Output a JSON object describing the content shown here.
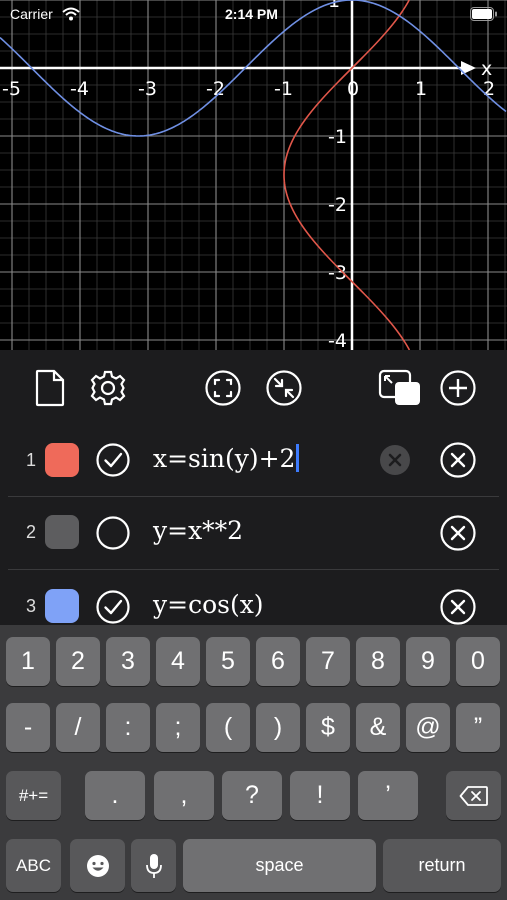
{
  "status_bar": {
    "carrier": "Carrier",
    "time": "2:14 PM"
  },
  "graph": {
    "axis_label_x": "x",
    "x_ticks": [
      "-5",
      "-4",
      "-3",
      "-2",
      "-1",
      "0",
      "1",
      "2"
    ],
    "y_ticks": [
      "1",
      "-1",
      "-2",
      "-3",
      "-4"
    ],
    "curve_colors": {
      "eq1": "#e0574a",
      "eq3": "#6f8fe3"
    }
  },
  "toolbar": {
    "new_doc": "doc-icon",
    "settings": "gear-icon",
    "fit_view": "fit-view-icon",
    "zoom_in": "compress-icon",
    "switch_view": "window-switch-icon",
    "add": "plus-circle-icon"
  },
  "equations": [
    {
      "index": "1",
      "color": "#ef6a5a",
      "checked": true,
      "text": "x=sin(y)+2",
      "editing": true
    },
    {
      "index": "2",
      "color": "#5d5d5f",
      "checked": false,
      "text": "y=x**2",
      "editing": false
    },
    {
      "index": "3",
      "color": "#7fa2f7",
      "checked": true,
      "text": "y=cos(x)",
      "editing": false
    }
  ],
  "keyboard": {
    "row1": [
      "1",
      "2",
      "3",
      "4",
      "5",
      "6",
      "7",
      "8",
      "9",
      "0"
    ],
    "row2": [
      "-",
      "/",
      ":",
      ";",
      "(",
      ")",
      "$",
      "&",
      "@",
      "”"
    ],
    "row3": {
      "symbols": "#+=",
      "keys": [
        ".",
        ",",
        "?",
        "!",
        "’"
      ],
      "delete": "delete-icon"
    },
    "row4": {
      "abc": "ABC",
      "emoji": "emoji-icon",
      "mic": "mic-icon",
      "space": "space",
      "return": "return"
    }
  }
}
